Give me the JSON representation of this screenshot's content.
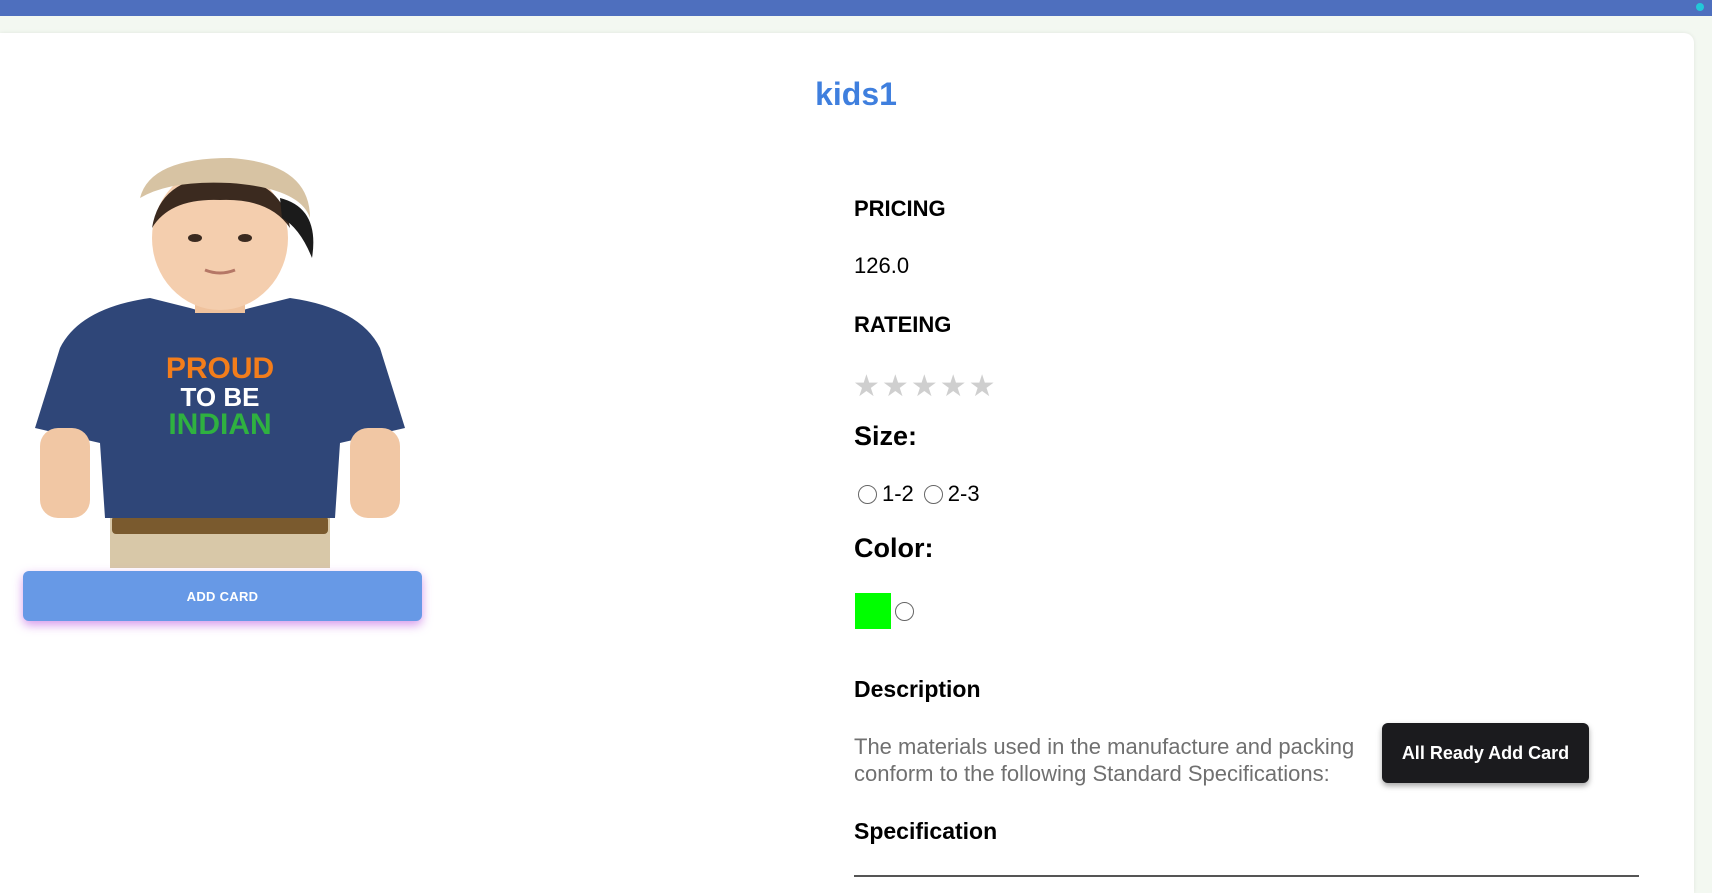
{
  "product": {
    "title": "kids1",
    "image_alt": "Kid wearing navy t-shirt with PROUD TO BE INDIAN print",
    "tshirt_text": [
      "PROUD",
      "TO BE",
      "INDIAN"
    ],
    "add_card_label": "ADD CARD"
  },
  "pricing": {
    "label": "PRICING",
    "value": "126.0"
  },
  "rating": {
    "label": "RATEING",
    "stars_total": 5,
    "stars_filled": 0,
    "star_glyph": "★"
  },
  "size": {
    "label": "Size:",
    "options": [
      "1-2",
      "2-3"
    ]
  },
  "color": {
    "label": "Color:",
    "swatch_color": "#00ff00"
  },
  "description": {
    "label": "Description",
    "text": "The materials used in the manufacture and packing conform to the following Standard Specifications:"
  },
  "specification": {
    "label": "Specification"
  },
  "toast": {
    "message": "All Ready Add Card"
  },
  "colors": {
    "topbar": "#4e6fbe",
    "title": "#3f7fde",
    "add_button": "#6799e6",
    "add_button_glow": "#c878e6",
    "toast_bg": "#1b1b1e"
  }
}
